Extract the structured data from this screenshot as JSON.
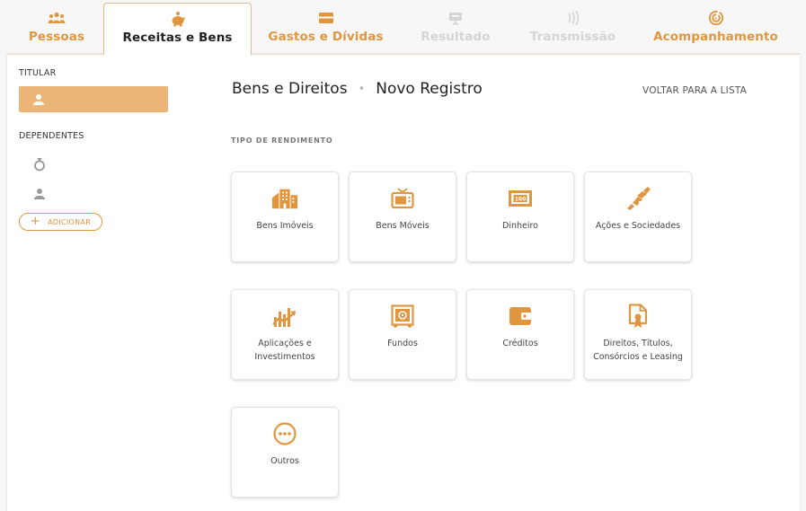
{
  "tabs": [
    {
      "id": "pessoas",
      "label": "Pessoas",
      "icon": "people-icon",
      "state": "enabled"
    },
    {
      "id": "receitas",
      "label": "Receitas e Bens",
      "icon": "piggy-bank-icon",
      "state": "active"
    },
    {
      "id": "gastos",
      "label": "Gastos e Dívidas",
      "icon": "wallet-card-icon",
      "state": "enabled"
    },
    {
      "id": "resultado",
      "label": "Resultado",
      "icon": "calculator-icon",
      "state": "disabled"
    },
    {
      "id": "transmissao",
      "label": "Transmissão",
      "icon": "signal-icon",
      "state": "disabled"
    },
    {
      "id": "acompanhamento",
      "label": "Acompanhamento",
      "icon": "radar-icon",
      "state": "enabled"
    }
  ],
  "sidebar": {
    "titular_heading": "TITULAR",
    "dependentes_heading": "DEPENDENTES",
    "add_label": "ADICIONAR"
  },
  "main": {
    "breadcrumb_section": "Bens e Direitos",
    "breadcrumb_current": "Novo Registro",
    "back_link": "VOLTAR PARA A LISTA",
    "section_label": "TIPO DE RENDIMENTO",
    "cards": [
      {
        "label": "Bens Imóveis",
        "icon": "buildings-icon"
      },
      {
        "label": "Bens Móveis",
        "icon": "tv-icon"
      },
      {
        "label": "Dinheiro",
        "icon": "banknote-icon"
      },
      {
        "label": "Ações e Sociedades",
        "icon": "handshake-icon"
      },
      {
        "label": "Aplicações e Investimentos",
        "icon": "chart-growth-icon"
      },
      {
        "label": "Fundos",
        "icon": "safe-icon"
      },
      {
        "label": "Créditos",
        "icon": "wallet-icon"
      },
      {
        "label": "Direitos, Títulos, Consórcios e Leasing",
        "icon": "certificate-icon"
      },
      {
        "label": "Outros",
        "icon": "more-icon"
      }
    ]
  },
  "colors": {
    "accent": "#e0963f",
    "accent_light": "#ebb577",
    "disabled": "#d4d4d4",
    "icon_gray": "#999999"
  }
}
